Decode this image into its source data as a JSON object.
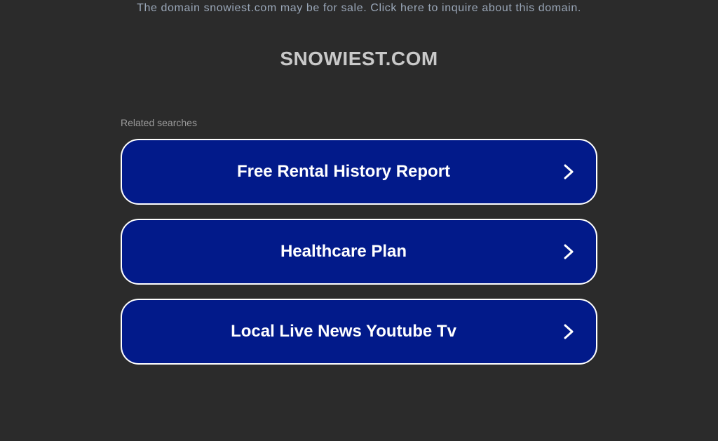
{
  "banner": {
    "text": "The domain snowiest.com may be for sale. Click here to inquire about this domain."
  },
  "header": {
    "title": "SNOWIEST.COM"
  },
  "related": {
    "label": "Related searches",
    "items": [
      {
        "label": "Free Rental History Report",
        "icon": "chevron-right-icon"
      },
      {
        "label": "Healthcare Plan",
        "icon": "chevron-right-icon"
      },
      {
        "label": "Local Live News Youtube Tv",
        "icon": "chevron-right-icon"
      }
    ]
  },
  "colors": {
    "background": "#2b2b2b",
    "button_fill": "#021a8a",
    "button_border": "#ffffff",
    "title_text": "#c9c9c9",
    "banner_text": "#9aa7b8"
  }
}
